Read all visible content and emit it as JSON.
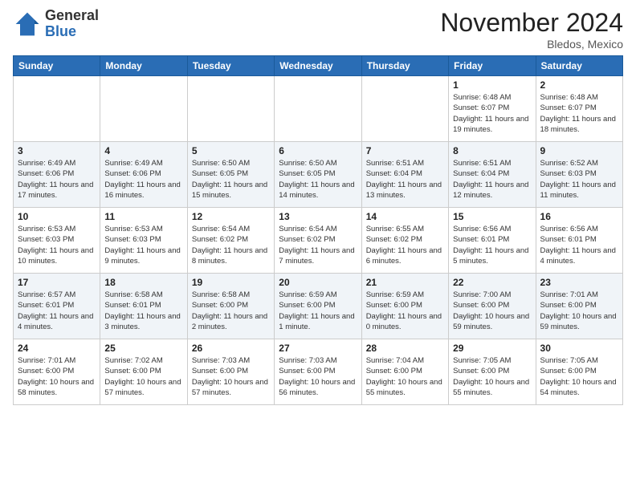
{
  "header": {
    "logo_general": "General",
    "logo_blue": "Blue",
    "month_title": "November 2024",
    "location": "Bledos, Mexico"
  },
  "weekdays": [
    "Sunday",
    "Monday",
    "Tuesday",
    "Wednesday",
    "Thursday",
    "Friday",
    "Saturday"
  ],
  "weeks": [
    [
      {
        "day": "",
        "info": ""
      },
      {
        "day": "",
        "info": ""
      },
      {
        "day": "",
        "info": ""
      },
      {
        "day": "",
        "info": ""
      },
      {
        "day": "",
        "info": ""
      },
      {
        "day": "1",
        "info": "Sunrise: 6:48 AM\nSunset: 6:07 PM\nDaylight: 11 hours\nand 19 minutes."
      },
      {
        "day": "2",
        "info": "Sunrise: 6:48 AM\nSunset: 6:07 PM\nDaylight: 11 hours\nand 18 minutes."
      }
    ],
    [
      {
        "day": "3",
        "info": "Sunrise: 6:49 AM\nSunset: 6:06 PM\nDaylight: 11 hours\nand 17 minutes."
      },
      {
        "day": "4",
        "info": "Sunrise: 6:49 AM\nSunset: 6:06 PM\nDaylight: 11 hours\nand 16 minutes."
      },
      {
        "day": "5",
        "info": "Sunrise: 6:50 AM\nSunset: 6:05 PM\nDaylight: 11 hours\nand 15 minutes."
      },
      {
        "day": "6",
        "info": "Sunrise: 6:50 AM\nSunset: 6:05 PM\nDaylight: 11 hours\nand 14 minutes."
      },
      {
        "day": "7",
        "info": "Sunrise: 6:51 AM\nSunset: 6:04 PM\nDaylight: 11 hours\nand 13 minutes."
      },
      {
        "day": "8",
        "info": "Sunrise: 6:51 AM\nSunset: 6:04 PM\nDaylight: 11 hours\nand 12 minutes."
      },
      {
        "day": "9",
        "info": "Sunrise: 6:52 AM\nSunset: 6:03 PM\nDaylight: 11 hours\nand 11 minutes."
      }
    ],
    [
      {
        "day": "10",
        "info": "Sunrise: 6:53 AM\nSunset: 6:03 PM\nDaylight: 11 hours\nand 10 minutes."
      },
      {
        "day": "11",
        "info": "Sunrise: 6:53 AM\nSunset: 6:03 PM\nDaylight: 11 hours\nand 9 minutes."
      },
      {
        "day": "12",
        "info": "Sunrise: 6:54 AM\nSunset: 6:02 PM\nDaylight: 11 hours\nand 8 minutes."
      },
      {
        "day": "13",
        "info": "Sunrise: 6:54 AM\nSunset: 6:02 PM\nDaylight: 11 hours\nand 7 minutes."
      },
      {
        "day": "14",
        "info": "Sunrise: 6:55 AM\nSunset: 6:02 PM\nDaylight: 11 hours\nand 6 minutes."
      },
      {
        "day": "15",
        "info": "Sunrise: 6:56 AM\nSunset: 6:01 PM\nDaylight: 11 hours\nand 5 minutes."
      },
      {
        "day": "16",
        "info": "Sunrise: 6:56 AM\nSunset: 6:01 PM\nDaylight: 11 hours\nand 4 minutes."
      }
    ],
    [
      {
        "day": "17",
        "info": "Sunrise: 6:57 AM\nSunset: 6:01 PM\nDaylight: 11 hours\nand 4 minutes."
      },
      {
        "day": "18",
        "info": "Sunrise: 6:58 AM\nSunset: 6:01 PM\nDaylight: 11 hours\nand 3 minutes."
      },
      {
        "day": "19",
        "info": "Sunrise: 6:58 AM\nSunset: 6:00 PM\nDaylight: 11 hours\nand 2 minutes."
      },
      {
        "day": "20",
        "info": "Sunrise: 6:59 AM\nSunset: 6:00 PM\nDaylight: 11 hours\nand 1 minute."
      },
      {
        "day": "21",
        "info": "Sunrise: 6:59 AM\nSunset: 6:00 PM\nDaylight: 11 hours\nand 0 minutes."
      },
      {
        "day": "22",
        "info": "Sunrise: 7:00 AM\nSunset: 6:00 PM\nDaylight: 10 hours\nand 59 minutes."
      },
      {
        "day": "23",
        "info": "Sunrise: 7:01 AM\nSunset: 6:00 PM\nDaylight: 10 hours\nand 59 minutes."
      }
    ],
    [
      {
        "day": "24",
        "info": "Sunrise: 7:01 AM\nSunset: 6:00 PM\nDaylight: 10 hours\nand 58 minutes."
      },
      {
        "day": "25",
        "info": "Sunrise: 7:02 AM\nSunset: 6:00 PM\nDaylight: 10 hours\nand 57 minutes."
      },
      {
        "day": "26",
        "info": "Sunrise: 7:03 AM\nSunset: 6:00 PM\nDaylight: 10 hours\nand 57 minutes."
      },
      {
        "day": "27",
        "info": "Sunrise: 7:03 AM\nSunset: 6:00 PM\nDaylight: 10 hours\nand 56 minutes."
      },
      {
        "day": "28",
        "info": "Sunrise: 7:04 AM\nSunset: 6:00 PM\nDaylight: 10 hours\nand 55 minutes."
      },
      {
        "day": "29",
        "info": "Sunrise: 7:05 AM\nSunset: 6:00 PM\nDaylight: 10 hours\nand 55 minutes."
      },
      {
        "day": "30",
        "info": "Sunrise: 7:05 AM\nSunset: 6:00 PM\nDaylight: 10 hours\nand 54 minutes."
      }
    ]
  ]
}
